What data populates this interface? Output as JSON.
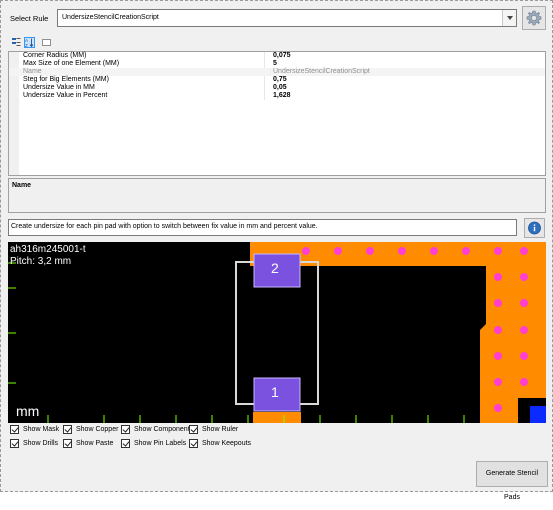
{
  "header": {
    "select_rule_label": "Select Rule",
    "rule_value": "UndersizeStencilCreationScript"
  },
  "icons": {
    "settings": "gear-icon",
    "categorized": "categorized-icon",
    "alphabetical": "sort-az-icon",
    "property_pages": "property-pages-icon",
    "info": "info-icon"
  },
  "properties": [
    {
      "name": "Corner Radius (MM)",
      "value": "0,075",
      "dim": false
    },
    {
      "name": "Max Size of one Element (MM)",
      "value": "5",
      "dim": false
    },
    {
      "name": "Name",
      "value": "UndersizeStencilCreationScript",
      "dim": true
    },
    {
      "name": "Steg for Big Elements (MM)",
      "value": "0,75",
      "dim": false
    },
    {
      "name": "Undersize Value in MM",
      "value": "0,05",
      "dim": false
    },
    {
      "name": "Undersize Value in Percent",
      "value": "1,628",
      "dim": false
    }
  ],
  "description_pane": {
    "title": "Name"
  },
  "rule_description": "Create undersize for each pin pad with option to switch between fix value in mm and percent value.",
  "preview": {
    "part_name": "ah316m245001-t",
    "pitch": "Pitch: 3,2 mm",
    "unit": "mm",
    "pad_labels": [
      "2",
      "1"
    ]
  },
  "checkboxes_row1": [
    {
      "label": "Show Mask",
      "checked": true
    },
    {
      "label": "Show Copper",
      "checked": true
    },
    {
      "label": "Show Component",
      "checked": true
    },
    {
      "label": "Show Ruler",
      "checked": true
    }
  ],
  "checkboxes_row2": [
    {
      "label": "Show Drills",
      "checked": true
    },
    {
      "label": "Show Paste",
      "checked": true
    },
    {
      "label": "Show Pin Labels",
      "checked": true
    },
    {
      "label": "Show Keepouts",
      "checked": true
    }
  ],
  "generate_button": "Generate Stencil Pads",
  "colors": {
    "copper": "#ff8c00",
    "drill": "#ff3fd2",
    "pad": "#7b52e0",
    "ruler": "#7cff00",
    "keepout": "#0a2aff"
  }
}
